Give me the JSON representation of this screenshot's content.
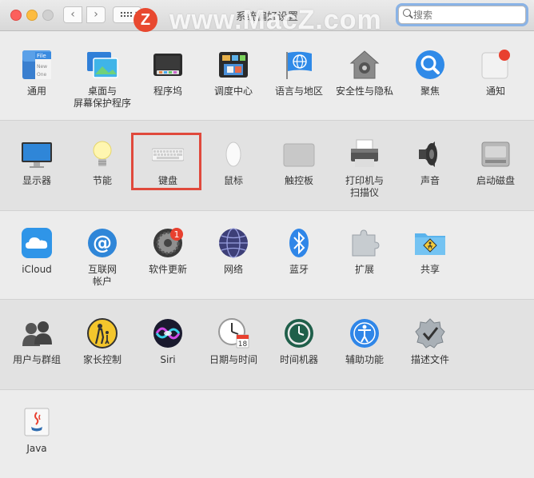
{
  "window": {
    "title": "系统偏好设置"
  },
  "search": {
    "placeholder": "搜索"
  },
  "watermark": {
    "logo": "Z",
    "text": "www.MacZ.com"
  },
  "rows": [
    [
      {
        "name": "general",
        "label": "通用",
        "icon": "general-icon"
      },
      {
        "name": "desktop-screensaver",
        "label": "桌面与\n屏幕保护程序",
        "icon": "desktop-icon"
      },
      {
        "name": "dock",
        "label": "程序坞",
        "icon": "dock-icon"
      },
      {
        "name": "mission-control",
        "label": "调度中心",
        "icon": "mission-control-icon"
      },
      {
        "name": "language-region",
        "label": "语言与地区",
        "icon": "flag-icon"
      },
      {
        "name": "security-privacy",
        "label": "安全性与隐私",
        "icon": "house-lock-icon"
      },
      {
        "name": "spotlight",
        "label": "聚焦",
        "icon": "magnifier-icon"
      },
      {
        "name": "notifications",
        "label": "通知",
        "icon": "notification-icon"
      }
    ],
    [
      {
        "name": "displays",
        "label": "显示器",
        "icon": "monitor-icon"
      },
      {
        "name": "energy-saver",
        "label": "节能",
        "icon": "bulb-icon"
      },
      {
        "name": "keyboard",
        "label": "键盘",
        "icon": "keyboard-icon"
      },
      {
        "name": "mouse",
        "label": "鼠标",
        "icon": "mouse-icon"
      },
      {
        "name": "trackpad",
        "label": "触控板",
        "icon": "trackpad-icon"
      },
      {
        "name": "printers-scanners",
        "label": "打印机与\n扫描仪",
        "icon": "printer-icon"
      },
      {
        "name": "sound",
        "label": "声音",
        "icon": "speaker-icon"
      },
      {
        "name": "startup-disk",
        "label": "启动磁盘",
        "icon": "disk-icon"
      }
    ],
    [
      {
        "name": "icloud",
        "label": "iCloud",
        "icon": "cloud-icon"
      },
      {
        "name": "internet-accounts",
        "label": "互联网\n帐户",
        "icon": "at-icon"
      },
      {
        "name": "software-update",
        "label": "软件更新",
        "icon": "gear-icon",
        "badge": "1"
      },
      {
        "name": "network",
        "label": "网络",
        "icon": "globe-icon"
      },
      {
        "name": "bluetooth",
        "label": "蓝牙",
        "icon": "bluetooth-icon"
      },
      {
        "name": "extensions",
        "label": "扩展",
        "icon": "puzzle-icon"
      },
      {
        "name": "sharing",
        "label": "共享",
        "icon": "folder-icon"
      }
    ],
    [
      {
        "name": "users-groups",
        "label": "用户与群组",
        "icon": "users-icon"
      },
      {
        "name": "parental-controls",
        "label": "家长控制",
        "icon": "parental-icon"
      },
      {
        "name": "siri",
        "label": "Siri",
        "icon": "siri-icon"
      },
      {
        "name": "date-time",
        "label": "日期与时间",
        "icon": "clock-icon",
        "calendar_day": "18"
      },
      {
        "name": "time-machine",
        "label": "时间机器",
        "icon": "time-machine-icon"
      },
      {
        "name": "accessibility",
        "label": "辅助功能",
        "icon": "accessibility-icon"
      },
      {
        "name": "profiles",
        "label": "描述文件",
        "icon": "checkmark-badge-icon"
      }
    ],
    [
      {
        "name": "java",
        "label": "Java",
        "icon": "java-icon"
      }
    ]
  ],
  "general_icon_text": {
    "line1": "File",
    "line2": "New",
    "line3": "One"
  },
  "selected": "keyboard"
}
